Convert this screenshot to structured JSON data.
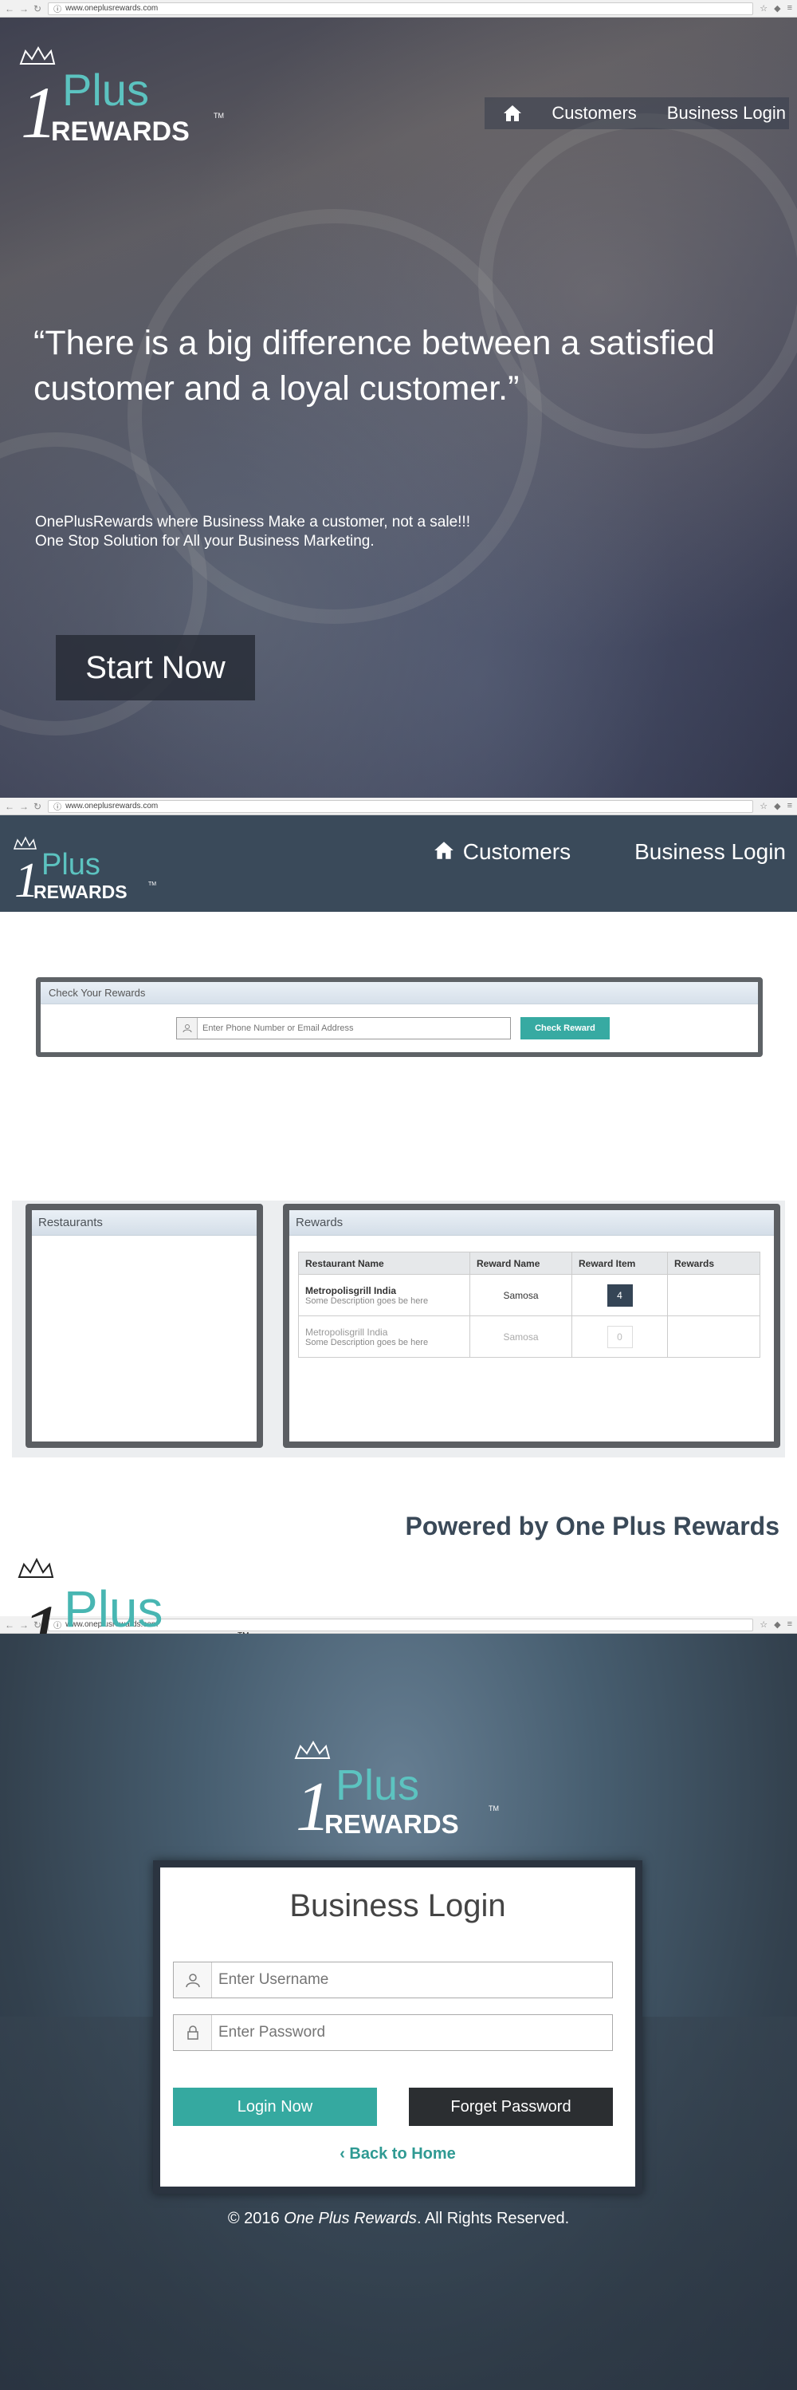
{
  "browser": {
    "url": "www.oneplusrewards.com"
  },
  "logo": {
    "one": "1",
    "plus": "Plus",
    "rewards": "REWARDS",
    "tm": "TM"
  },
  "hero": {
    "menu": {
      "customers": "Customers",
      "business_login": "Business Login"
    },
    "quote": "“There is a big difference between a satisfied customer and a loyal customer.”",
    "tagline_line1": "OnePlusRewards where Business Make a customer, not a sale!!!",
    "tagline_line2": "One Stop Solution for All your Business Marketing.",
    "start_button": "Start Now"
  },
  "rewards_page": {
    "nav": {
      "customers": "Customers",
      "business_login": "Business Login"
    },
    "check_panel_title": "Check Your Rewards",
    "check_placeholder": "Enter Phone Number or Email Address",
    "check_button": "Check Reward",
    "restaurants_title": "Restaurants",
    "rewards_title": "Rewards",
    "table_headers": [
      "Restaurant Name",
      "Reward Name",
      "Reward Item",
      "Rewards"
    ],
    "rows": [
      {
        "name": "Metropolisgrill India",
        "desc": "Some Description goes be here",
        "reward_name": "Samosa",
        "reward_item": "4"
      },
      {
        "name": "Metropolisgrill India",
        "desc": "Some Description goes be here",
        "reward_name": "Samosa",
        "reward_item": "0"
      }
    ],
    "powered_by": "Powered by One Plus Rewards"
  },
  "login_page": {
    "title": "Business Login",
    "username_placeholder": "Enter Username",
    "password_placeholder": "Enter Password",
    "login_button": "Login Now",
    "forget_button": "Forget Password",
    "back_home": "Back to Home",
    "footer_prefix": "© 2016 ",
    "footer_brand": "One Plus Rewards",
    "footer_suffix": ". All Rights Reserved."
  },
  "colors": {
    "teal": "#37aaa2",
    "navy": "#3a4a5a",
    "dark": "#2b2e31"
  }
}
